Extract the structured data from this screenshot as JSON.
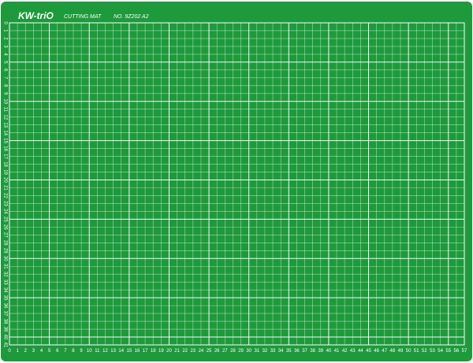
{
  "mat": {
    "brand": "KW-triO",
    "product_label": "CUTTING MAT",
    "model_label": "NO. 9Z202  A2",
    "bottom_scale": [
      "0",
      "1",
      "2",
      "3",
      "4",
      "5",
      "6",
      "7",
      "8",
      "9",
      "10",
      "11",
      "12",
      "13",
      "14",
      "15",
      "16",
      "17",
      "18",
      "19",
      "20",
      "21",
      "22",
      "23",
      "24",
      "25",
      "26",
      "27",
      "28",
      "29",
      "30",
      "31",
      "32",
      "33",
      "34",
      "35",
      "36",
      "37",
      "38",
      "39",
      "40",
      "41",
      "42",
      "43",
      "44",
      "45",
      "46",
      "47",
      "48",
      "49",
      "50",
      "51",
      "52",
      "53",
      "54",
      "55",
      "56",
      "57"
    ],
    "left_scale": [
      "0",
      "1",
      "2",
      "3",
      "4",
      "5",
      "6",
      "7",
      "8",
      "9",
      "10",
      "11",
      "12",
      "13",
      "14",
      "15",
      "16",
      "17",
      "18",
      "19",
      "20",
      "21",
      "22",
      "23",
      "24",
      "25",
      "26",
      "27",
      "28",
      "29",
      "30",
      "31",
      "32",
      "33",
      "34",
      "35",
      "36",
      "37",
      "38",
      "39",
      "40",
      "41"
    ],
    "colors": {
      "mat_green": "#1e9a3c",
      "edge_green": "#17813a",
      "grid_line": "#ffffff"
    }
  }
}
